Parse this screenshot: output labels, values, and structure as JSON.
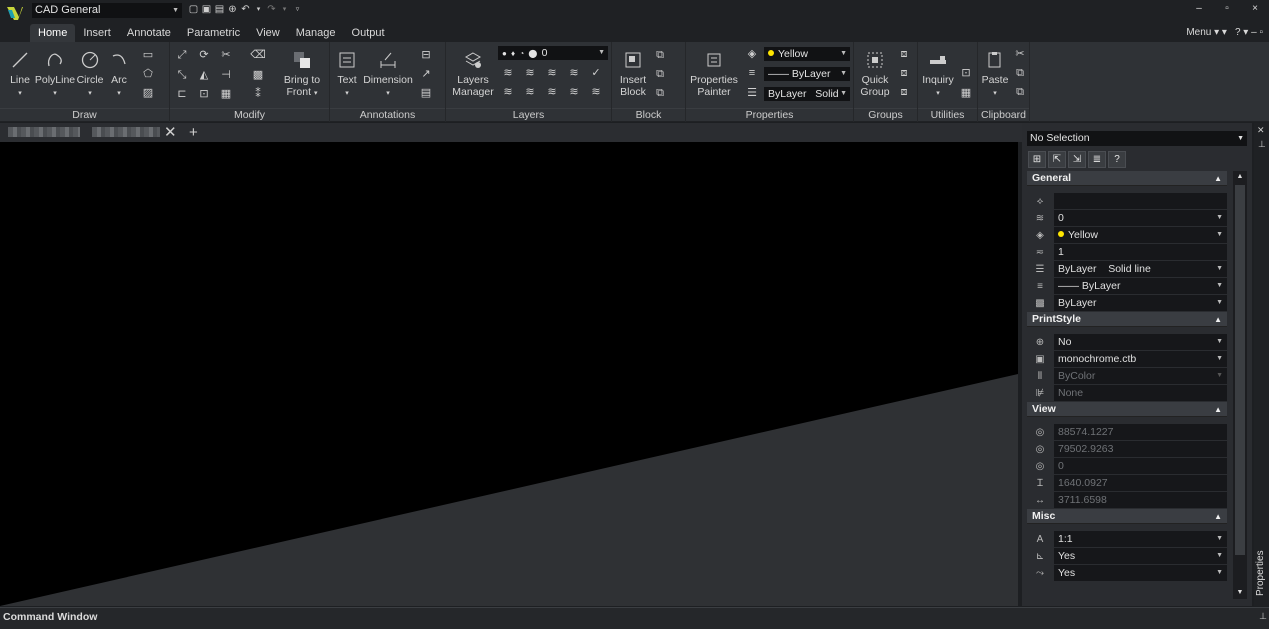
{
  "titlebar": {
    "workspace": "CAD General",
    "qat_icons": [
      "new-icon",
      "open-icon",
      "save-icon",
      "print-icon",
      "undo-icon",
      "undo-dropdown-icon",
      "redo-icon",
      "redo-dropdown-icon",
      "customize-icon"
    ],
    "window_controls": [
      "–",
      "▫",
      "×"
    ]
  },
  "tabs": [
    "Home",
    "Insert",
    "Annotate",
    "Parametric",
    "View",
    "Manage",
    "Output"
  ],
  "menu_right": {
    "menu": "Menu",
    "help": "?"
  },
  "ribbon": {
    "draw": {
      "title": "Draw",
      "line": "Line",
      "polyline": "PolyLine",
      "circle": "Circle",
      "arc": "Arc"
    },
    "modify": {
      "title": "Modify",
      "bring_to": "Bring to",
      "front": "Front"
    },
    "annotations": {
      "title": "Annotations",
      "text": "Text",
      "dimension": "Dimension"
    },
    "layers": {
      "title": "Layers",
      "layers_l1": "Layers",
      "layers_l2": "Manager",
      "current_layer": "0"
    },
    "block": {
      "title": "Block",
      "insert_l1": "Insert",
      "insert_l2": "Block"
    },
    "properties": {
      "title": "Properties",
      "painter_l1": "Properties",
      "painter_l2": "Painter",
      "color": "Yellow",
      "lineweight": "—— ByLayer",
      "linetype": "ByLayer",
      "linetype_style": "Solid"
    },
    "groups": {
      "title": "Groups",
      "quick_l1": "Quick",
      "quick_l2": "Group"
    },
    "utilities": {
      "title": "Utilities",
      "inquiry": "Inquiry"
    },
    "clipboard": {
      "title": "Clipboard",
      "paste": "Paste"
    }
  },
  "colors": {
    "accent_yellow": "#ffe600",
    "canvas": "#000000",
    "panel": "#2f3236"
  },
  "properties_palette": {
    "selection": "No Selection",
    "help_label": "?",
    "sections": {
      "general": {
        "title": "General",
        "rows": [
          {
            "icon": "color-icon",
            "value": ""
          },
          {
            "icon": "layer-icon",
            "value": "0"
          },
          {
            "icon": "color-icon",
            "value": "Yellow"
          },
          {
            "icon": "linetype-scale-icon",
            "value": "1"
          },
          {
            "icon": "linetype-icon",
            "value": "ByLayer",
            "value2": "Solid line"
          },
          {
            "icon": "lineweight-icon",
            "value": "—— ByLayer"
          },
          {
            "icon": "transparency-icon",
            "value": "ByLayer"
          }
        ]
      },
      "printstyle": {
        "title": "PrintStyle",
        "rows": [
          {
            "value": "No"
          },
          {
            "value": "monochrome.ctb"
          },
          {
            "value": "ByColor"
          },
          {
            "value": "None"
          }
        ]
      },
      "view": {
        "title": "View",
        "rows": [
          {
            "value": "88574.1227"
          },
          {
            "value": "79502.9263"
          },
          {
            "value": "0"
          },
          {
            "value": "1640.0927"
          },
          {
            "value": "3711.6598"
          }
        ]
      },
      "misc": {
        "title": "Misc",
        "rows": [
          {
            "value": "1:1"
          },
          {
            "value": "Yes"
          },
          {
            "value": "Yes"
          }
        ]
      }
    },
    "side_tab": "Properties"
  },
  "command_window": {
    "title": "Command Window"
  }
}
